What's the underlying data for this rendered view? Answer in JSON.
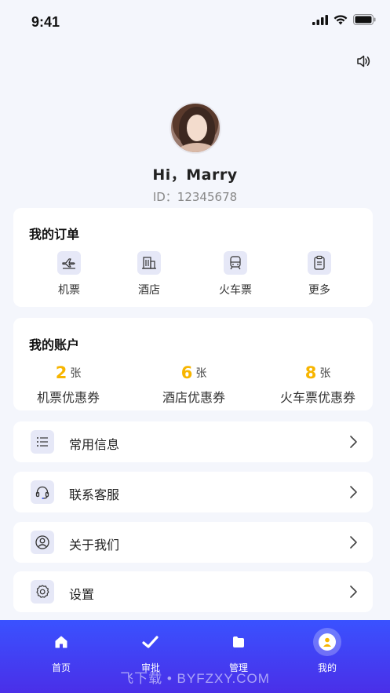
{
  "status_bar": {
    "time": "9:41"
  },
  "profile": {
    "greeting": "Hi，Marry",
    "id_text": "ID：12345678"
  },
  "orders": {
    "title": "我的订单",
    "items": [
      {
        "label": "机票",
        "icon": "airplane-icon"
      },
      {
        "label": "酒店",
        "icon": "hotel-icon"
      },
      {
        "label": "火车票",
        "icon": "train-icon"
      },
      {
        "label": "更多",
        "icon": "clipboard-icon"
      }
    ]
  },
  "account": {
    "title": "我的账户",
    "coupons": [
      {
        "count": "2",
        "unit": "张",
        "label": "机票优惠券"
      },
      {
        "count": "6",
        "unit": "张",
        "label": "酒店优惠券"
      },
      {
        "count": "8",
        "unit": "张",
        "label": "火车票优惠券"
      }
    ]
  },
  "menu": [
    {
      "label": "常用信息",
      "icon": "list-icon"
    },
    {
      "label": "联系客服",
      "icon": "headset-icon"
    },
    {
      "label": "关于我们",
      "icon": "user-circle-icon"
    },
    {
      "label": "设置",
      "icon": "gear-icon"
    }
  ],
  "tabbar": {
    "tabs": [
      {
        "label": "首页",
        "icon": "home-icon"
      },
      {
        "label": "审批",
        "icon": "approve-icon"
      },
      {
        "label": "管理",
        "icon": "folder-icon"
      },
      {
        "label": "我的",
        "icon": "profile-icon",
        "active": true
      }
    ]
  },
  "watermark": "飞下载 • BYFZXY.COM",
  "colors": {
    "accent": "#3a52ff",
    "coupon_number": "#f7b500",
    "icon_bg": "#e6e8f7"
  }
}
